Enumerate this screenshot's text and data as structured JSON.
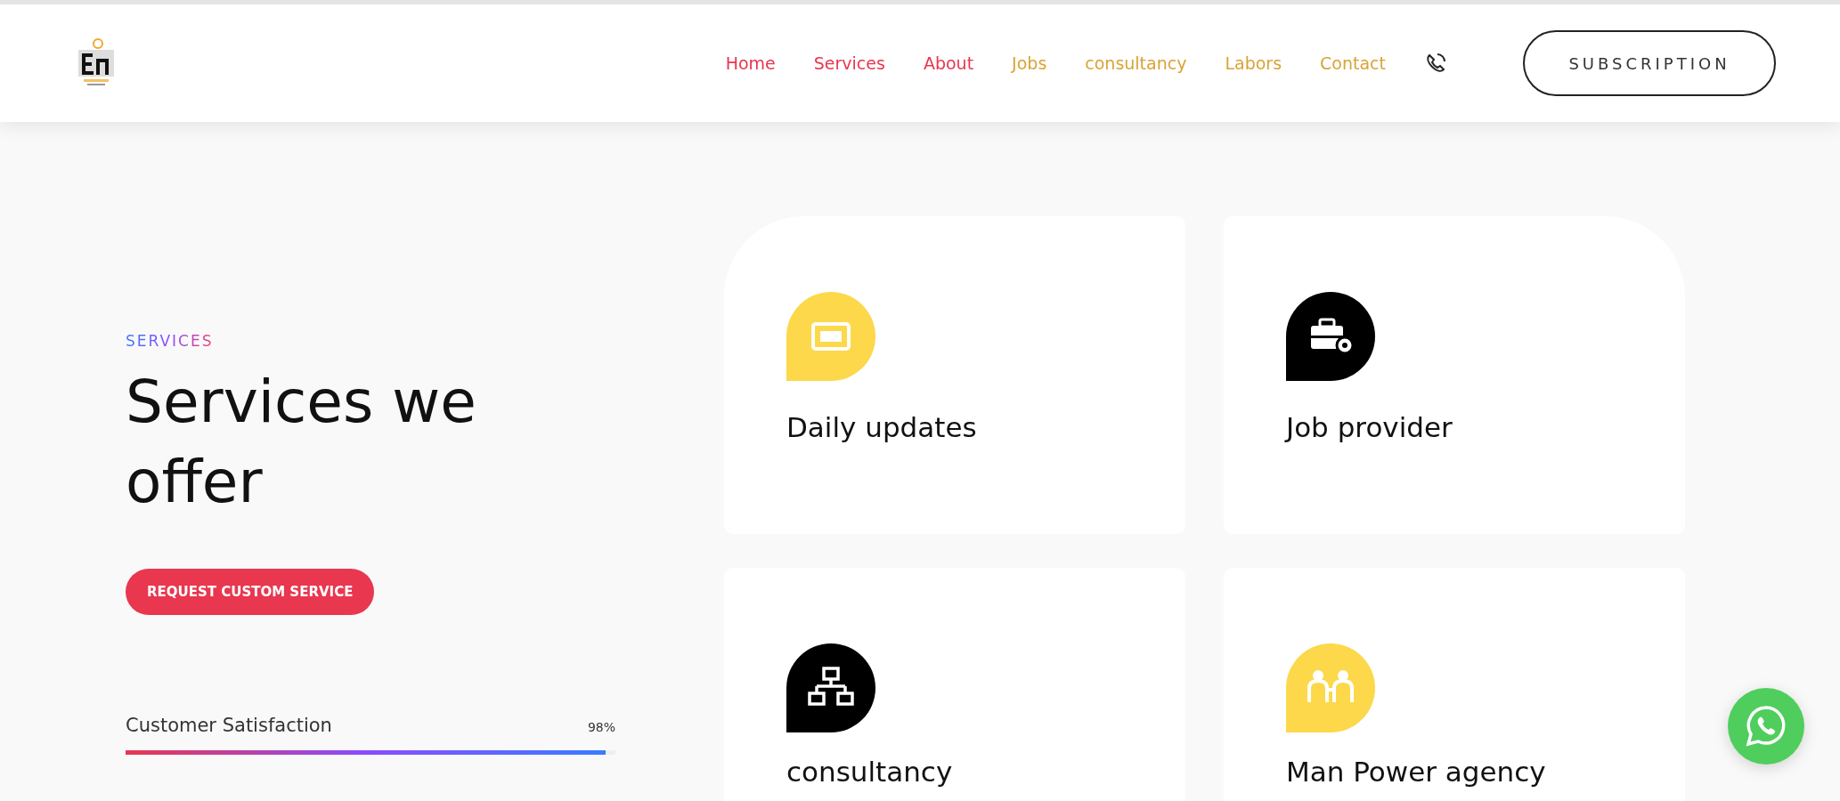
{
  "header": {
    "nav": [
      {
        "label": "Home",
        "color": "#e8374f"
      },
      {
        "label": "Services",
        "color": "#e8374f"
      },
      {
        "label": "About",
        "color": "#e8374f"
      },
      {
        "label": "Jobs",
        "color": "#d9a336"
      },
      {
        "label": "consultancy",
        "color": "#d9a336"
      },
      {
        "label": "Labors",
        "color": "#d9a336"
      },
      {
        "label": "Contact",
        "color": "#d9a336"
      }
    ],
    "button": "SUBSCRIPTION"
  },
  "intro": {
    "eyebrow": "SERVICES",
    "heading": "Services we offer",
    "button": "REQUEST CUSTOM SERVICE",
    "skill": {
      "label": "Customer Satisfaction",
      "reading": "98%",
      "level": 0.98
    }
  },
  "cards": [
    {
      "title": "Daily updates",
      "kind": "screen",
      "color": "#fcd84a"
    },
    {
      "title": "Job provider",
      "kind": "briefcase",
      "color": "#000000"
    },
    {
      "title": "consultancy",
      "kind": "network",
      "color": "#000000"
    },
    {
      "title": "Man Power agency",
      "kind": "people",
      "color": "#fcd84a"
    }
  ]
}
